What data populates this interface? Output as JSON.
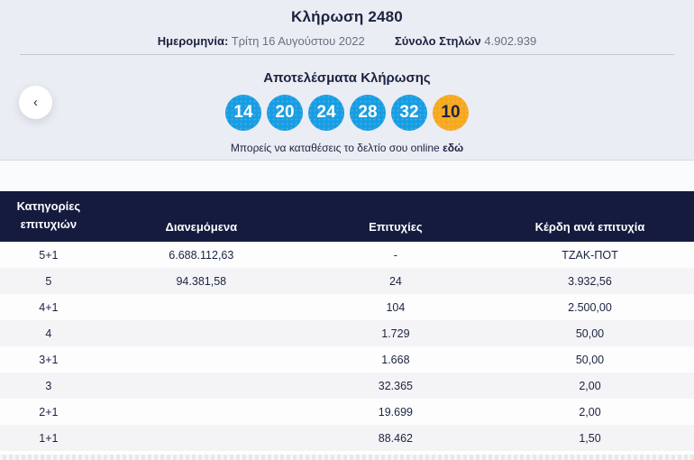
{
  "header": {
    "title": "Κλήρωση 2480",
    "date_label": "Ημερομηνία:",
    "date_value": "Τρίτη 16 Αυγούστου 2022",
    "columns_label": "Σύνολο Στηλών",
    "columns_value": "4.902.939"
  },
  "results": {
    "title": "Αποτελέσματα Κλήρωσης",
    "numbers": [
      "14",
      "20",
      "24",
      "28",
      "32"
    ],
    "joker": "10",
    "note_text": "Μπορείς να καταθέσεις το δελτίο σου online",
    "note_link": "εδώ"
  },
  "icons": {
    "prev_arrow": "‹"
  },
  "prize_table": {
    "headers": [
      "Κατηγορίες επιτυχιών",
      "Διανεμόμενα",
      "Επιτυχίες",
      "Κέρδη ανά επιτυχία"
    ],
    "rows": [
      {
        "category": "5+1",
        "distributed": "6.688.112,63",
        "winners": "-",
        "prize": "ΤΖΑΚ-ΠΟΤ"
      },
      {
        "category": "5",
        "distributed": "94.381,58",
        "winners": "24",
        "prize": "3.932,56"
      },
      {
        "category": "4+1",
        "distributed": "",
        "winners": "104",
        "prize": "2.500,00"
      },
      {
        "category": "4",
        "distributed": "",
        "winners": "1.729",
        "prize": "50,00"
      },
      {
        "category": "3+1",
        "distributed": "",
        "winners": "1.668",
        "prize": "50,00"
      },
      {
        "category": "3",
        "distributed": "",
        "winners": "32.365",
        "prize": "2,00"
      },
      {
        "category": "2+1",
        "distributed": "",
        "winners": "19.699",
        "prize": "2,00"
      },
      {
        "category": "1+1",
        "distributed": "",
        "winners": "88.462",
        "prize": "1,50"
      }
    ]
  },
  "colors": {
    "main_ball": "#199de2",
    "joker_ball": "#f6a81f",
    "table_header_bg": "#141b3e",
    "navy_text": "#1b2341",
    "section_bg": "#ebedf4"
  }
}
